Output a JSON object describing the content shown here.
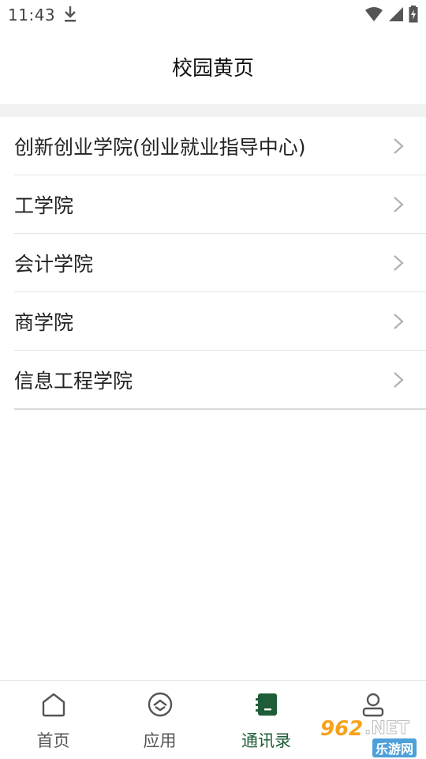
{
  "status_bar": {
    "time": "11:43"
  },
  "header": {
    "title": "校园黄页"
  },
  "colleges": [
    {
      "label": "创新创业学院(创业就业指导中心)"
    },
    {
      "label": "工学院"
    },
    {
      "label": "会计学院"
    },
    {
      "label": "商学院"
    },
    {
      "label": "信息工程学院"
    }
  ],
  "bottom_nav": {
    "items": [
      {
        "label": "首页",
        "icon": "home-icon"
      },
      {
        "label": "应用",
        "icon": "apps-icon"
      },
      {
        "label": "通讯录",
        "icon": "contacts-book-icon",
        "active": true
      },
      {
        "label": "我的",
        "icon": "profile-icon"
      }
    ]
  },
  "colors": {
    "accent": "#1e5d38",
    "divider": "#e4e4e4"
  },
  "watermark": {
    "brand": "962",
    "domain": ".NET",
    "sub": "乐游网"
  }
}
